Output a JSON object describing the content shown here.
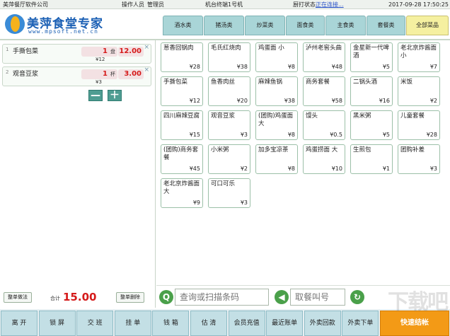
{
  "topbar": {
    "company": "美萍餐厅软件公司",
    "operator_label": "操作人员",
    "operator": "管理员",
    "terminal_label": "机台终端",
    "terminal": "1号机",
    "kitchen_label": "厨打状态",
    "kitchen_status": "正在连接...",
    "datetime": "2017-09-28 17:50:25"
  },
  "brand": {
    "name": "美萍食堂专家",
    "url": "www.mpsoft.net.cn"
  },
  "tabs": [
    "酒水类",
    "猪汤类",
    "炒菜类",
    "面食类",
    "主食类",
    "套餐类",
    "全部菜品"
  ],
  "active_tab": "全部菜品",
  "order_items": [
    {
      "seq": "1",
      "name": "手撕包菜",
      "qty": "1",
      "unit": "盘",
      "price": "12.00",
      "unit_price": "¥12"
    },
    {
      "seq": "2",
      "name": "观音豆浆",
      "qty": "1",
      "unit": "杯",
      "price": "3.00",
      "unit_price": "¥3"
    }
  ],
  "qty_buttons": {
    "minus": "—",
    "plus": "＋"
  },
  "left_footer": {
    "left_button": "整单做法",
    "total_label": "合计",
    "total": "15.00",
    "right_button": "整单删除"
  },
  "dishes": [
    {
      "name": "葱香回锅肉",
      "price": "¥28"
    },
    {
      "name": "毛氏红烧肉",
      "price": "¥38"
    },
    {
      "name": "鸡蛋面 小",
      "price": "¥8"
    },
    {
      "name": "泸州老窖头曲",
      "price": "¥48"
    },
    {
      "name": "金星新一代啤酒",
      "price": "¥5"
    },
    {
      "name": "老北京炸酱面小",
      "price": "¥7"
    },
    {
      "name": "手撕包菜",
      "price": "¥12"
    },
    {
      "name": "鱼香肉丝",
      "price": "¥20"
    },
    {
      "name": "麻辣鱼锅",
      "price": "¥38"
    },
    {
      "name": "商务套餐",
      "price": "¥58"
    },
    {
      "name": "二锅头酒",
      "price": "¥16"
    },
    {
      "name": "米饭",
      "price": "¥2"
    },
    {
      "name": "四川麻辣豆腐",
      "price": "¥15"
    },
    {
      "name": "观音豆浆",
      "price": "¥3"
    },
    {
      "name": "(团购)鸡蛋面大",
      "price": "¥8"
    },
    {
      "name": "馒头",
      "price": "¥0.5"
    },
    {
      "name": "黑米粥",
      "price": "¥5"
    },
    {
      "name": "儿童套餐",
      "price": "¥28"
    },
    {
      "name": "(团购)商务套餐",
      "price": "¥45"
    },
    {
      "name": "小米粥",
      "price": "¥2"
    },
    {
      "name": "加多宝凉茶",
      "price": "¥8"
    },
    {
      "name": "鸡蛋捞面 大",
      "price": "¥10"
    },
    {
      "name": "生煎包",
      "price": "¥1"
    },
    {
      "name": "团购补差",
      "price": "¥3"
    },
    {
      "name": "老北京炸酱面大",
      "price": "¥9"
    },
    {
      "name": "可口可乐",
      "price": "¥3"
    }
  ],
  "search": {
    "placeholder": "查询或扫描条码"
  },
  "callnum": {
    "placeholder": "取餐叫号"
  },
  "bottom_buttons": [
    "离 开",
    "锁 屏",
    "交 班",
    "挂 单",
    "钱 箱",
    "估 清",
    "会员充值",
    "最近账单",
    "外卖回款",
    "外卖下单",
    "快速结帐"
  ],
  "watermark": "下载吧"
}
